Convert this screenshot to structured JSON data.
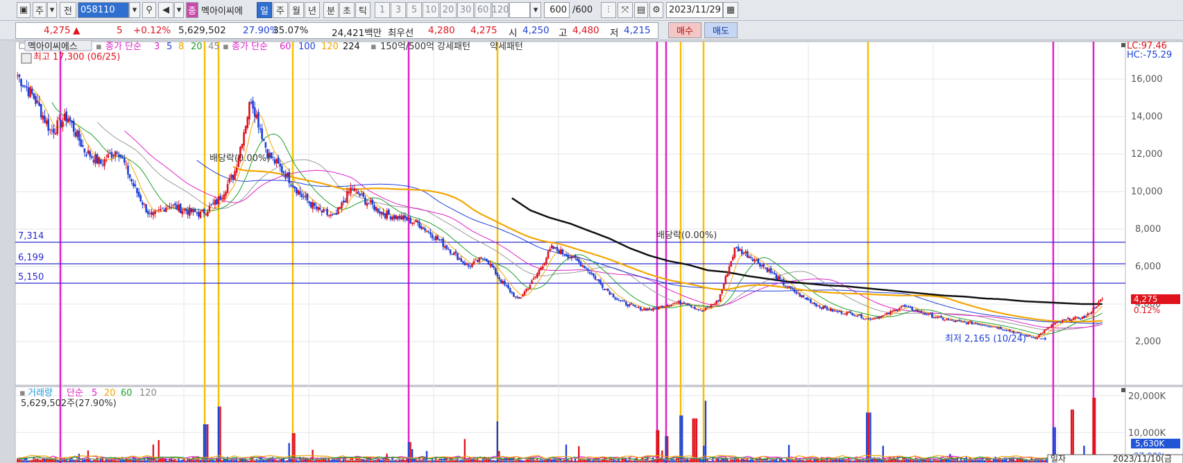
{
  "toolbar": {
    "period_btn": "주",
    "prev_btn": "전",
    "stock_code": "058110",
    "main_btn": "종",
    "stock_name": "멕아이씨에",
    "periods": [
      "일",
      "주",
      "월",
      "년",
      "분",
      "초",
      "틱"
    ],
    "active_period": "일",
    "intervals": [
      "1",
      "3",
      "5",
      "10",
      "20",
      "30",
      "60",
      "120"
    ],
    "count_value": "600",
    "count_total": "/600",
    "date": "2023/11/29"
  },
  "quote": {
    "price": "4,275",
    "arrow": "▲",
    "change": "5",
    "change_pct": "+0.12%",
    "volume": "5,629,502",
    "turnover": "27.90%",
    "ratio": "35.07%",
    "amount": "24,421백만",
    "best_label": "최우선",
    "best_ask": "4,280",
    "best_bid": "4,275",
    "open_label": "시",
    "open": "4,250",
    "high_label": "고",
    "high": "4,480",
    "low_label": "저",
    "low": "4,215",
    "buy_btn": "매수",
    "sell_btn": "매도"
  },
  "legend": {
    "name": "멕아이씨에스",
    "ma1_prefix": "종가 단순",
    "ma1_periods": [
      "3",
      "5",
      "8",
      "20",
      "45"
    ],
    "ma2_prefix": "종가 단순",
    "ma2_periods": [
      "60",
      "100",
      "120",
      "224"
    ],
    "pattern": "150억/500억 강세패턴",
    "pattern2": "약세패턴",
    "high_mark": "최고 17,300 (06/25)",
    "low_mark": "최저 2,165 (10/24)",
    "dividend1": "배당락(0.00%)",
    "dividend2": "배당락(0.00%)",
    "lc": "LC:97.46",
    "hc": "HC:-75.29",
    "last_price": "4,275",
    "last_pct": "0.12%"
  },
  "levels": [
    "7,314",
    "6,199",
    "5,150"
  ],
  "volume_panel": {
    "title": "거래량",
    "prefix": "단순",
    "periods": [
      "5",
      "20",
      "60",
      "120"
    ],
    "summary": "5,629,502주(27.90%)",
    "axis": [
      "20,000K",
      "10,000K"
    ],
    "current": "5,630K",
    "current_pct": "27.90%",
    "footer_label": "일자",
    "footer_date": "2023/11/10(금"
  },
  "colors": {
    "up": "#e0121b",
    "down": "#1d3fd6",
    "ma224": "#111111",
    "ma120": "#f3a500",
    "magenta": "#e020c8",
    "yellow": "#f5c000"
  },
  "chart_data": {
    "type": "candlestick",
    "y_axis_ticks": [
      2000,
      4000,
      6000,
      8000,
      10000,
      12000,
      14000,
      16000
    ],
    "price_close": [
      16200,
      15000,
      13200,
      14000,
      12200,
      11500,
      12300,
      10200,
      8600,
      9300,
      9000,
      8800,
      9500,
      11000,
      15000,
      12000,
      11000,
      9800,
      9000,
      8600,
      10200,
      9400,
      8800,
      8600,
      8300,
      7600,
      6800,
      6000,
      6500,
      5200,
      4200,
      5400,
      7000,
      6600,
      6000,
      5000,
      4200,
      3800,
      3700,
      4000,
      4100,
      3600,
      4200,
      7000,
      6500,
      5800,
      5000,
      4400,
      3900,
      3600,
      3500,
      3200,
      3400,
      3900,
      3600,
      3300,
      3100,
      3000,
      2900,
      2700,
      2400,
      2200,
      2900,
      3200,
      3300,
      4275
    ],
    "ma224": [
      null,
      null,
      null,
      null,
      null,
      null,
      null,
      null,
      null,
      null,
      null,
      null,
      null,
      null,
      null,
      null,
      null,
      null,
      null,
      null,
      null,
      null,
      null,
      null,
      null,
      9700,
      9000,
      8600,
      8300,
      7900,
      7500,
      7000,
      6600,
      6300,
      6100,
      5800,
      5700,
      5500,
      5350,
      5200,
      5100,
      5000,
      4950,
      4850,
      4750,
      4650,
      4550,
      4450,
      4400,
      4300,
      4250,
      4150,
      4100,
      4050,
      4000,
      4000
    ]
  }
}
